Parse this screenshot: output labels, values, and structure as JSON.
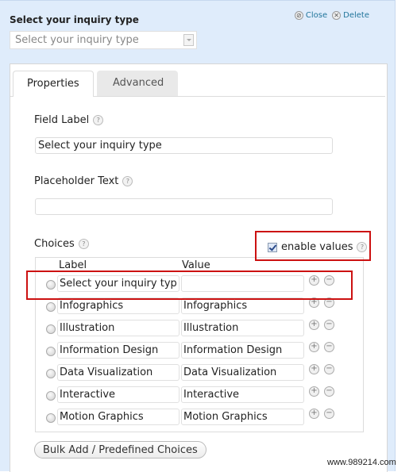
{
  "field": {
    "title": "Select your inquiry type",
    "preview_select_value": "Select your inquiry type"
  },
  "actions": {
    "close_label": "Close",
    "delete_label": "Delete"
  },
  "tabs": [
    {
      "label": "Properties",
      "active": true
    },
    {
      "label": "Advanced",
      "active": false
    }
  ],
  "properties": {
    "field_label_title": "Field Label",
    "field_label_value": "Select your inquiry type",
    "placeholder_title": "Placeholder Text",
    "placeholder_value": "",
    "choices_title": "Choices",
    "enable_values_label": "enable values",
    "enable_values_checked": true,
    "col_label": "Label",
    "col_value": "Value",
    "choices": [
      {
        "label": "Select your inquiry type",
        "value": ""
      },
      {
        "label": "Infographics",
        "value": "Infographics"
      },
      {
        "label": "Illustration",
        "value": "Illustration"
      },
      {
        "label": "Information Design",
        "value": "Information Design"
      },
      {
        "label": "Data Visualization",
        "value": "Data Visualization"
      },
      {
        "label": "Interactive",
        "value": "Interactive"
      },
      {
        "label": "Motion Graphics",
        "value": "Motion Graphics"
      }
    ],
    "bulk_add_label": "Bulk Add / Predefined Choices",
    "help_glyph": "?"
  },
  "icons": {
    "close": "⊘",
    "delete": "✕",
    "plus": "+",
    "minus": "−"
  },
  "highlight_color": "#cc1111",
  "watermark": "www.989214.com"
}
